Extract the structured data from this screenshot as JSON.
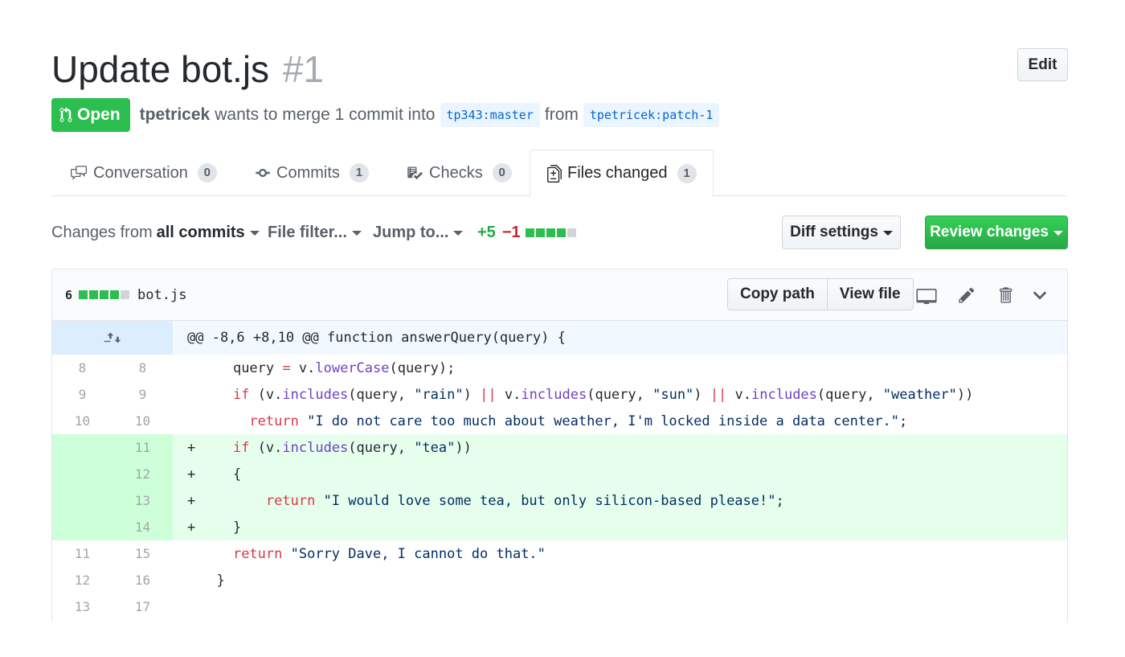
{
  "pr": {
    "title": "Update bot.js",
    "number": "#1",
    "edit_label": "Edit",
    "state_label": "Open",
    "author": "tpetricek",
    "merge_text": "wants to merge 1 commit into",
    "base_branch": "tp343:master",
    "from_text": "from",
    "head_branch": "tpetricek:patch-1"
  },
  "tabs": [
    {
      "label": "Conversation",
      "count": "0"
    },
    {
      "label": "Commits",
      "count": "1"
    },
    {
      "label": "Checks",
      "count": "0"
    },
    {
      "label": "Files changed",
      "count": "1"
    }
  ],
  "toolbar": {
    "changes_prefix": "Changes from",
    "changes_value": "all commits",
    "file_filter": "File filter...",
    "jump_to": "Jump to...",
    "additions": "+5",
    "deletions": "−1",
    "diff_settings": "Diff settings",
    "review_changes": "Review changes"
  },
  "file": {
    "change_count": "6",
    "name": "bot.js",
    "copy_path": "Copy path",
    "view_file": "View file",
    "hunk_header": "@@ -8,6 +8,10 @@ function answerQuery(query) {"
  },
  "lines": [
    {
      "old": "8",
      "new": "8",
      "marker": "",
      "type": "ctx"
    },
    {
      "old": "9",
      "new": "9",
      "marker": "",
      "type": "ctx"
    },
    {
      "old": "10",
      "new": "10",
      "marker": "",
      "type": "ctx"
    },
    {
      "old": "",
      "new": "11",
      "marker": "+",
      "type": "add"
    },
    {
      "old": "",
      "new": "12",
      "marker": "+",
      "type": "add"
    },
    {
      "old": "",
      "new": "13",
      "marker": "+",
      "type": "add"
    },
    {
      "old": "",
      "new": "14",
      "marker": "+",
      "type": "add"
    },
    {
      "old": "11",
      "new": "15",
      "marker": "",
      "type": "ctx"
    },
    {
      "old": "12",
      "new": "16",
      "marker": "",
      "type": "ctx"
    },
    {
      "old": "13",
      "new": "17",
      "marker": "",
      "type": "ctx"
    }
  ],
  "code": {
    "l1_a": "query",
    "l1_b": "=",
    "l1_c": "v.",
    "l1_d": "lowerCase",
    "l1_e": "(query);",
    "l2_if": "if",
    "l2_a": "(v.",
    "l2_inc": "includes",
    "l2_b": "(query, ",
    "l2_s1": "\"rain\"",
    "l2_c": ")",
    "l2_or": "||",
    "l2_d": "v.",
    "l2_e": "(query, ",
    "l2_s2": "\"sun\"",
    "l2_f": ")",
    "l2_g": "v.",
    "l2_h": "(query, ",
    "l2_s3": "\"weather\"",
    "l2_i": "))",
    "l3_ret": "return",
    "l3_s": "\"I do not care too much about weather, I'm locked inside a data center.\"",
    "l3_end": ";",
    "l4_if": "if",
    "l4_a": "(v.",
    "l4_inc": "includes",
    "l4_b": "(query, ",
    "l4_s": "\"tea\"",
    "l4_c": "))",
    "l5": "{",
    "l6_ret": "return",
    "l6_s": "\"I would love some tea, but only silicon-based please!\"",
    "l6_end": ";",
    "l7": "}",
    "l8_ret": "return",
    "l8_s": "\"Sorry Dave, I cannot do that.\"",
    "l9": "}"
  },
  "colors": {
    "open_green": "#2cbe4e",
    "link_blue": "#0366d6",
    "add_bg": "#e6ffed",
    "add_gutter": "#cdffd8",
    "keyword": "#d73a49",
    "string": "#032f62",
    "function": "#6f42c1"
  },
  "icons": [
    "git-pull-request-icon",
    "comment-discussion-icon",
    "git-commit-icon",
    "checklist-icon",
    "file-diff-icon",
    "expand-icon",
    "desktop-icon",
    "pencil-icon",
    "trash-icon",
    "chevron-down-icon"
  ]
}
